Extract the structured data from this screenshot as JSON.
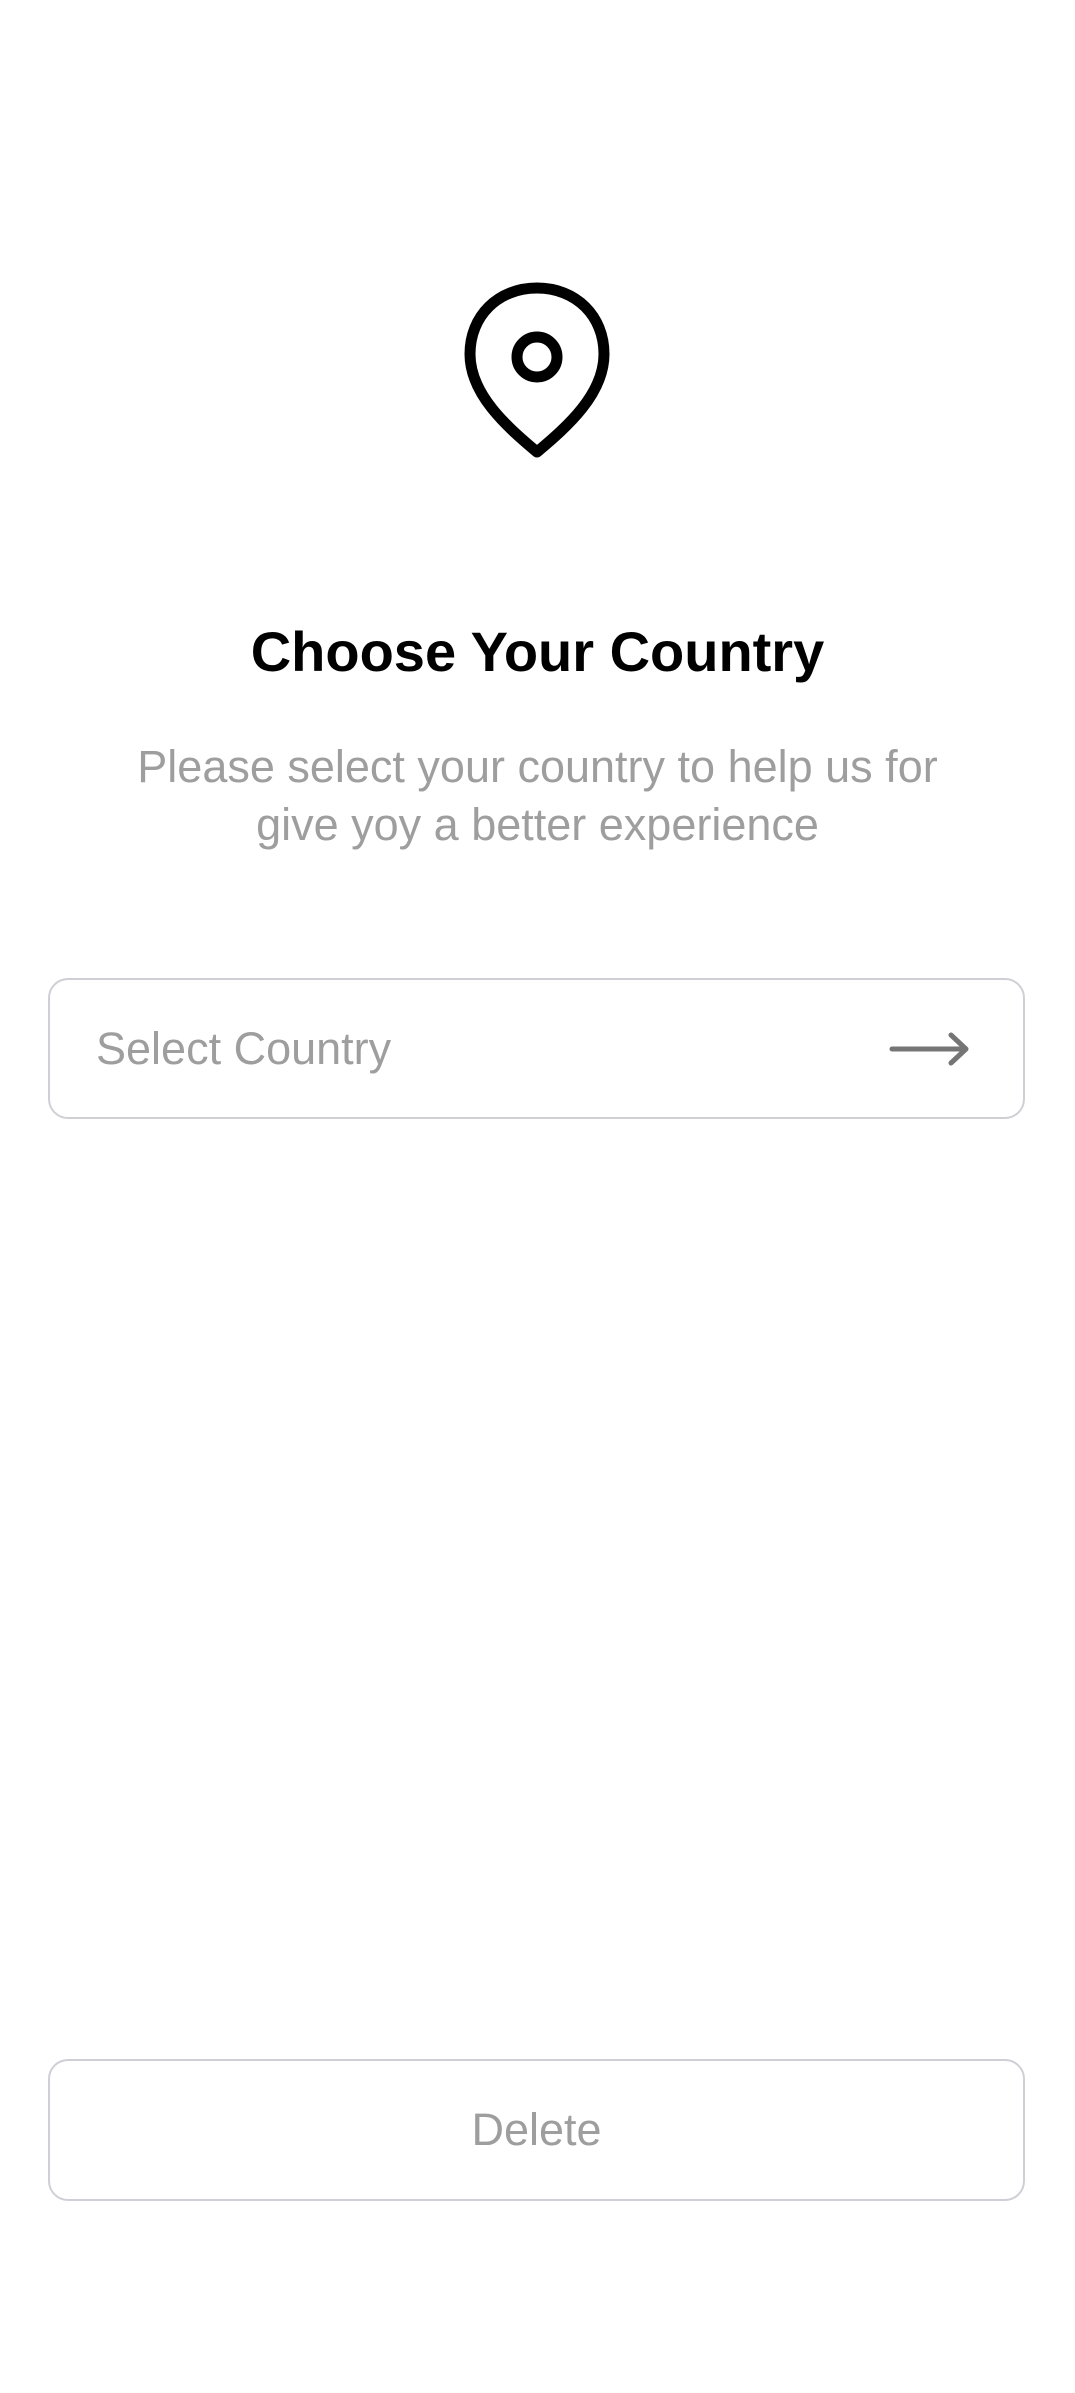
{
  "header": {
    "icon": "location-pin-icon",
    "title": "Choose Your Country",
    "subtitle": "Please select your country to help us for give yoy a better experience"
  },
  "country_select": {
    "placeholder": "Select Country",
    "icon": "arrow-right-icon"
  },
  "footer": {
    "delete_label": "Delete"
  },
  "colors": {
    "title": "#000000",
    "muted_text": "#9e9e9e",
    "border": "#cfcfd6",
    "background": "#ffffff"
  }
}
